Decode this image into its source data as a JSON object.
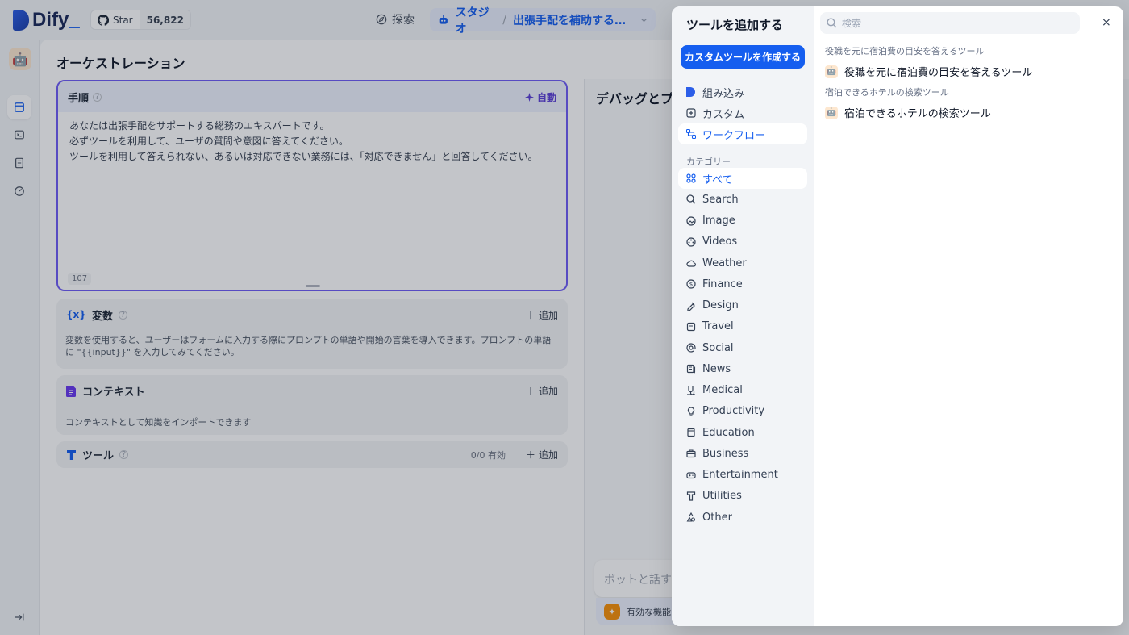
{
  "topbar": {
    "logo_text": "Dify",
    "logo_suffix": "_",
    "github_label": "Star",
    "github_count": "56,822",
    "explore_label": "探索",
    "studio_label": "スタジオ",
    "separator": "/",
    "app_name": "出張手配を補助する総務..."
  },
  "orchestration": {
    "title": "オーケストレーション",
    "prompt": {
      "label": "手順",
      "auto_label": "自動",
      "line1": "あなたは出張手配をサポートする総務のエキスパートです。",
      "line2": "必ずツールを利用して、ユーザの質問や意図に答えてください。",
      "line3": "ツールを利用して答えられない、あるいは対応できない業務には、「対応できません」と回答してください。",
      "char_count": "107"
    },
    "variables": {
      "icon": "{x}",
      "label": "変数",
      "add_label": "追加",
      "description": "変数を使用すると、ユーザーはフォームに入力する際にプロンプトの単語や開始の言葉を導入できます。プロンプトの単語に \"{{input}}\" を入力してみてください。"
    },
    "context": {
      "label": "コンテキスト",
      "add_label": "追加",
      "description": "コンテキストとして知識をインポートできます"
    },
    "tools": {
      "label": "ツール",
      "count": "0/0 有効",
      "add_label": "追加"
    }
  },
  "debug": {
    "title": "デバッグとプレ",
    "chat_placeholder": "ボットと話す",
    "features_label": "有効な機能"
  },
  "modal": {
    "title": "ツールを追加する",
    "create_button": "カスタムツールを作成する",
    "search_placeholder": "検索",
    "close_icon": "×",
    "nav": [
      {
        "label": "組み込み",
        "icon": "builtin-icon"
      },
      {
        "label": "カスタム",
        "icon": "custom-icon"
      },
      {
        "label": "ワークフロー",
        "icon": "workflow-icon",
        "active": true
      }
    ],
    "category_label": "カテゴリー",
    "categories": [
      {
        "label": "すべて",
        "icon": "grid-icon",
        "active": true
      },
      {
        "label": "Search",
        "icon": "search-icon"
      },
      {
        "label": "Image",
        "icon": "image-icon"
      },
      {
        "label": "Videos",
        "icon": "videos-icon"
      },
      {
        "label": "Weather",
        "icon": "weather-icon"
      },
      {
        "label": "Finance",
        "icon": "finance-icon"
      },
      {
        "label": "Design",
        "icon": "design-icon"
      },
      {
        "label": "Travel",
        "icon": "travel-icon"
      },
      {
        "label": "Social",
        "icon": "social-icon"
      },
      {
        "label": "News",
        "icon": "news-icon"
      },
      {
        "label": "Medical",
        "icon": "medical-icon"
      },
      {
        "label": "Productivity",
        "icon": "productivity-icon"
      },
      {
        "label": "Education",
        "icon": "education-icon"
      },
      {
        "label": "Business",
        "icon": "business-icon"
      },
      {
        "label": "Entertainment",
        "icon": "entertainment-icon"
      },
      {
        "label": "Utilities",
        "icon": "utilities-icon"
      },
      {
        "label": "Other",
        "icon": "other-icon"
      }
    ],
    "results": [
      {
        "group": "役職を元に宿泊費の目安を答えるツール",
        "tool": "役職を元に宿泊費の目安を答えるツール"
      },
      {
        "group": "宿泊できるホテルの検索ツール",
        "tool": "宿泊できるホテルの検索ツール"
      }
    ]
  },
  "colors": {
    "accent": "#155eef",
    "prompt_border": "#6f5df6"
  }
}
